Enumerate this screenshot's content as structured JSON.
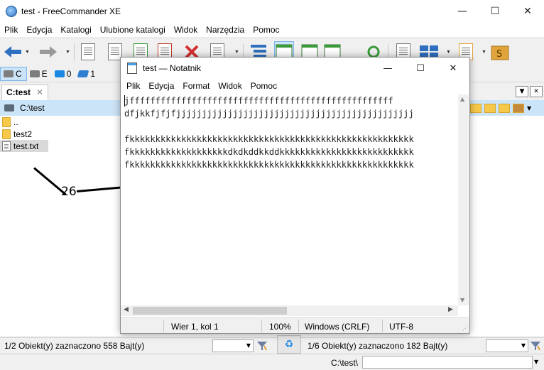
{
  "fc": {
    "title": "test - FreeCommander XE",
    "menu": [
      "Plik",
      "Edycja",
      "Katalogi",
      "Ulubione katalogi",
      "Widok",
      "Narzędzia",
      "Pomoc"
    ],
    "drives": [
      {
        "label": "C",
        "active": true
      },
      {
        "label": "E",
        "active": false
      },
      {
        "label": "0",
        "active": false
      },
      {
        "label": "1",
        "active": false
      }
    ],
    "left_tab": "C:test",
    "left_path": "C:\\test",
    "left_files": [
      {
        "name": "..",
        "type": "folder"
      },
      {
        "name": "test2",
        "type": "folder"
      },
      {
        "name": "test.txt",
        "type": "file"
      }
    ],
    "status_left": "1/2 Obiekt(y) zaznaczono   558 Bajt(y)",
    "status_right": "1/6 Obiekt(y) zaznaczono   182 Bajt(y)",
    "path_line": "C:\\test\\"
  },
  "annotation": {
    "number": "26"
  },
  "notepad": {
    "title": "test — Notatnik",
    "menu": [
      "Plik",
      "Edycja",
      "Format",
      "Widok",
      "Pomoc"
    ],
    "content": "jfffffffffffffffffffffffffffffffffffffffffffffffffff\ndfjkkfjfjfjjjjjjjjjjjjjjjjjjjjjjjjjjjjjjjjjjjjjjjjjjjjjj\n\nfkkkkkkkkkkkkkkkkkkkkkkkkkkkkkkkkkkkkkkkkkkkkkkkkkkkkkkk\nfkkkkkkkkkkkkkkkkkkkdkdkddkkddkkkkkkkkkkkkkkkkkkkkkkkkkk\nfkkkkkkkkkkkkkkkkkkkkkkkkkkkkkkkkkkkkkkkkkkkkkkkkkkkkkkk",
    "status": {
      "position": "Wier 1, kol 1",
      "zoom": "100%",
      "line_ending": "Windows (CRLF)",
      "encoding": "UTF-8"
    }
  }
}
